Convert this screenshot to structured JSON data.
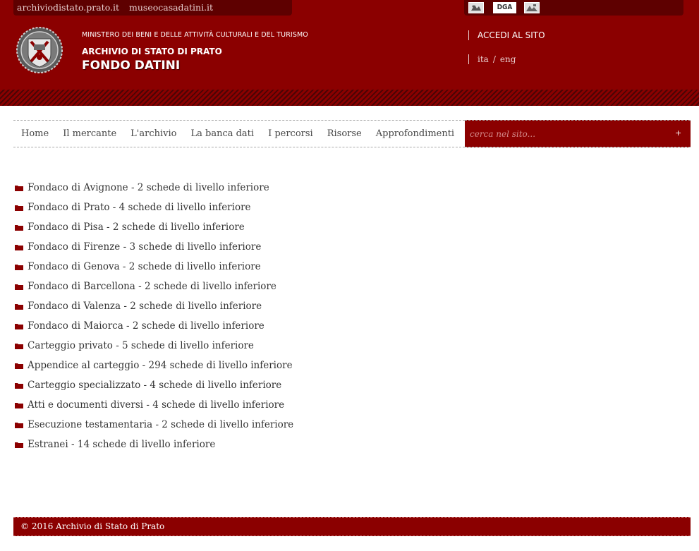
{
  "topbar": {
    "links": [
      "archiviodistato.prato.it",
      "museocasadatini.it"
    ],
    "partner_logos": [
      {
        "name": "logo-1",
        "text": ""
      },
      {
        "name": "dga-logo",
        "text": "DGA"
      },
      {
        "name": "logo-3",
        "text": ""
      }
    ]
  },
  "header": {
    "ministry": "MINISTERO DEI BENI E DELLE ATTIVITÀ CULTURALI E DEL TURISMO",
    "archive": "ARCHIVIO DI STATO DI PRATO",
    "title": "FONDO DATINI",
    "login": "ACCEDI AL SITO",
    "lang": {
      "ita": "ita",
      "sep": "/",
      "eng": "eng"
    }
  },
  "nav": {
    "items": [
      "Home",
      "Il mercante",
      "L'archivio",
      "La banca dati",
      "I percorsi",
      "Risorse",
      "Approfondimenti"
    ]
  },
  "search": {
    "placeholder": "cerca nel sito...",
    "button": "+"
  },
  "list": [
    "Fondaco di Avignone - 2 schede di livello inferiore",
    "Fondaco di Prato - 4 schede di livello inferiore",
    "Fondaco di Pisa - 2 schede di livello inferiore",
    "Fondaco di Firenze - 3 schede di livello inferiore",
    "Fondaco di Genova - 2 schede di livello inferiore",
    "Fondaco di Barcellona - 2 schede di livello inferiore",
    "Fondaco di Valenza - 2 schede di livello inferiore",
    "Fondaco di Maiorca - 2 schede di livello inferiore",
    "Carteggio privato - 5 schede di livello inferiore",
    "Appendice al carteggio - 294 schede di livello inferiore",
    "Carteggio specializzato - 4 schede di livello inferiore",
    "Atti e documenti diversi - 4 schede di livello inferiore",
    "Esecuzione testamentaria - 2 schede di livello inferiore",
    "Estranei - 14 schede di livello inferiore"
  ],
  "footer": {
    "copyright": "© 2016 Archivio di Stato di Prato"
  },
  "colors": {
    "brand": "#8b0000",
    "dark_brand": "#5e0000"
  }
}
